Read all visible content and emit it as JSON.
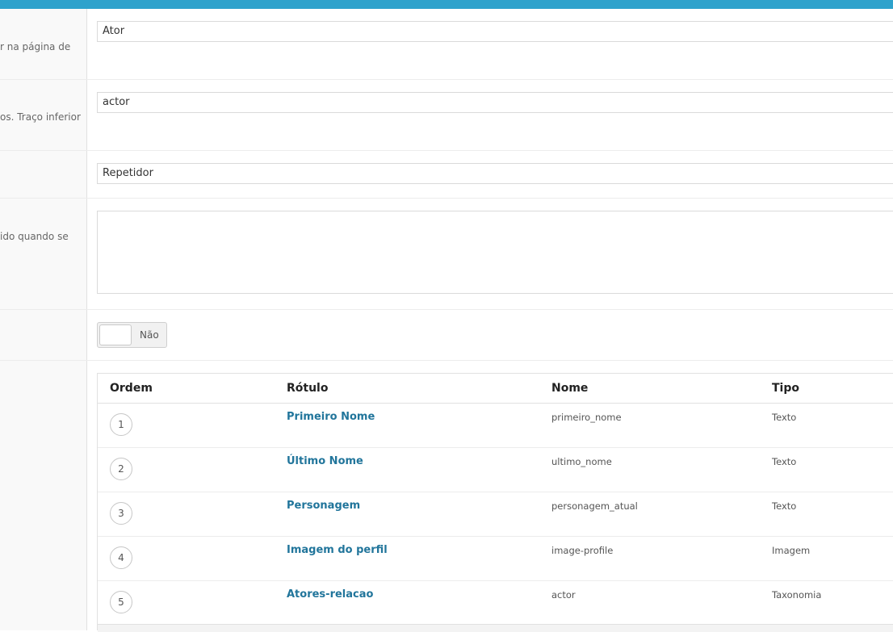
{
  "form": {
    "labels": {
      "field_label_help": "r na página de",
      "field_name_help": "os. Traço inferior",
      "instructions_help": "ido quando se"
    },
    "field_label_value": "Ator",
    "field_name_value": "actor",
    "field_type_value": "Repetidor",
    "instructions_value": "",
    "required_toggle": "Não"
  },
  "subfields": {
    "headers": {
      "order": "Ordem",
      "label": "Rótulo",
      "name": "Nome",
      "type": "Tipo"
    },
    "rows": [
      {
        "order": "1",
        "label": "Primeiro Nome",
        "name": "primeiro_nome",
        "type": "Texto"
      },
      {
        "order": "2",
        "label": "Último Nome",
        "name": "ultimo_nome",
        "type": "Texto"
      },
      {
        "order": "3",
        "label": "Personagem",
        "name": "personagem_atual",
        "type": "Texto"
      },
      {
        "order": "4",
        "label": "Imagem do perfil",
        "name": "image-profile",
        "type": "Imagem"
      },
      {
        "order": "5",
        "label": "Atores-relacao",
        "name": "actor",
        "type": "Taxonomia"
      }
    ]
  },
  "colors": {
    "topbar": "#2ea2cc",
    "link": "#21759b"
  }
}
